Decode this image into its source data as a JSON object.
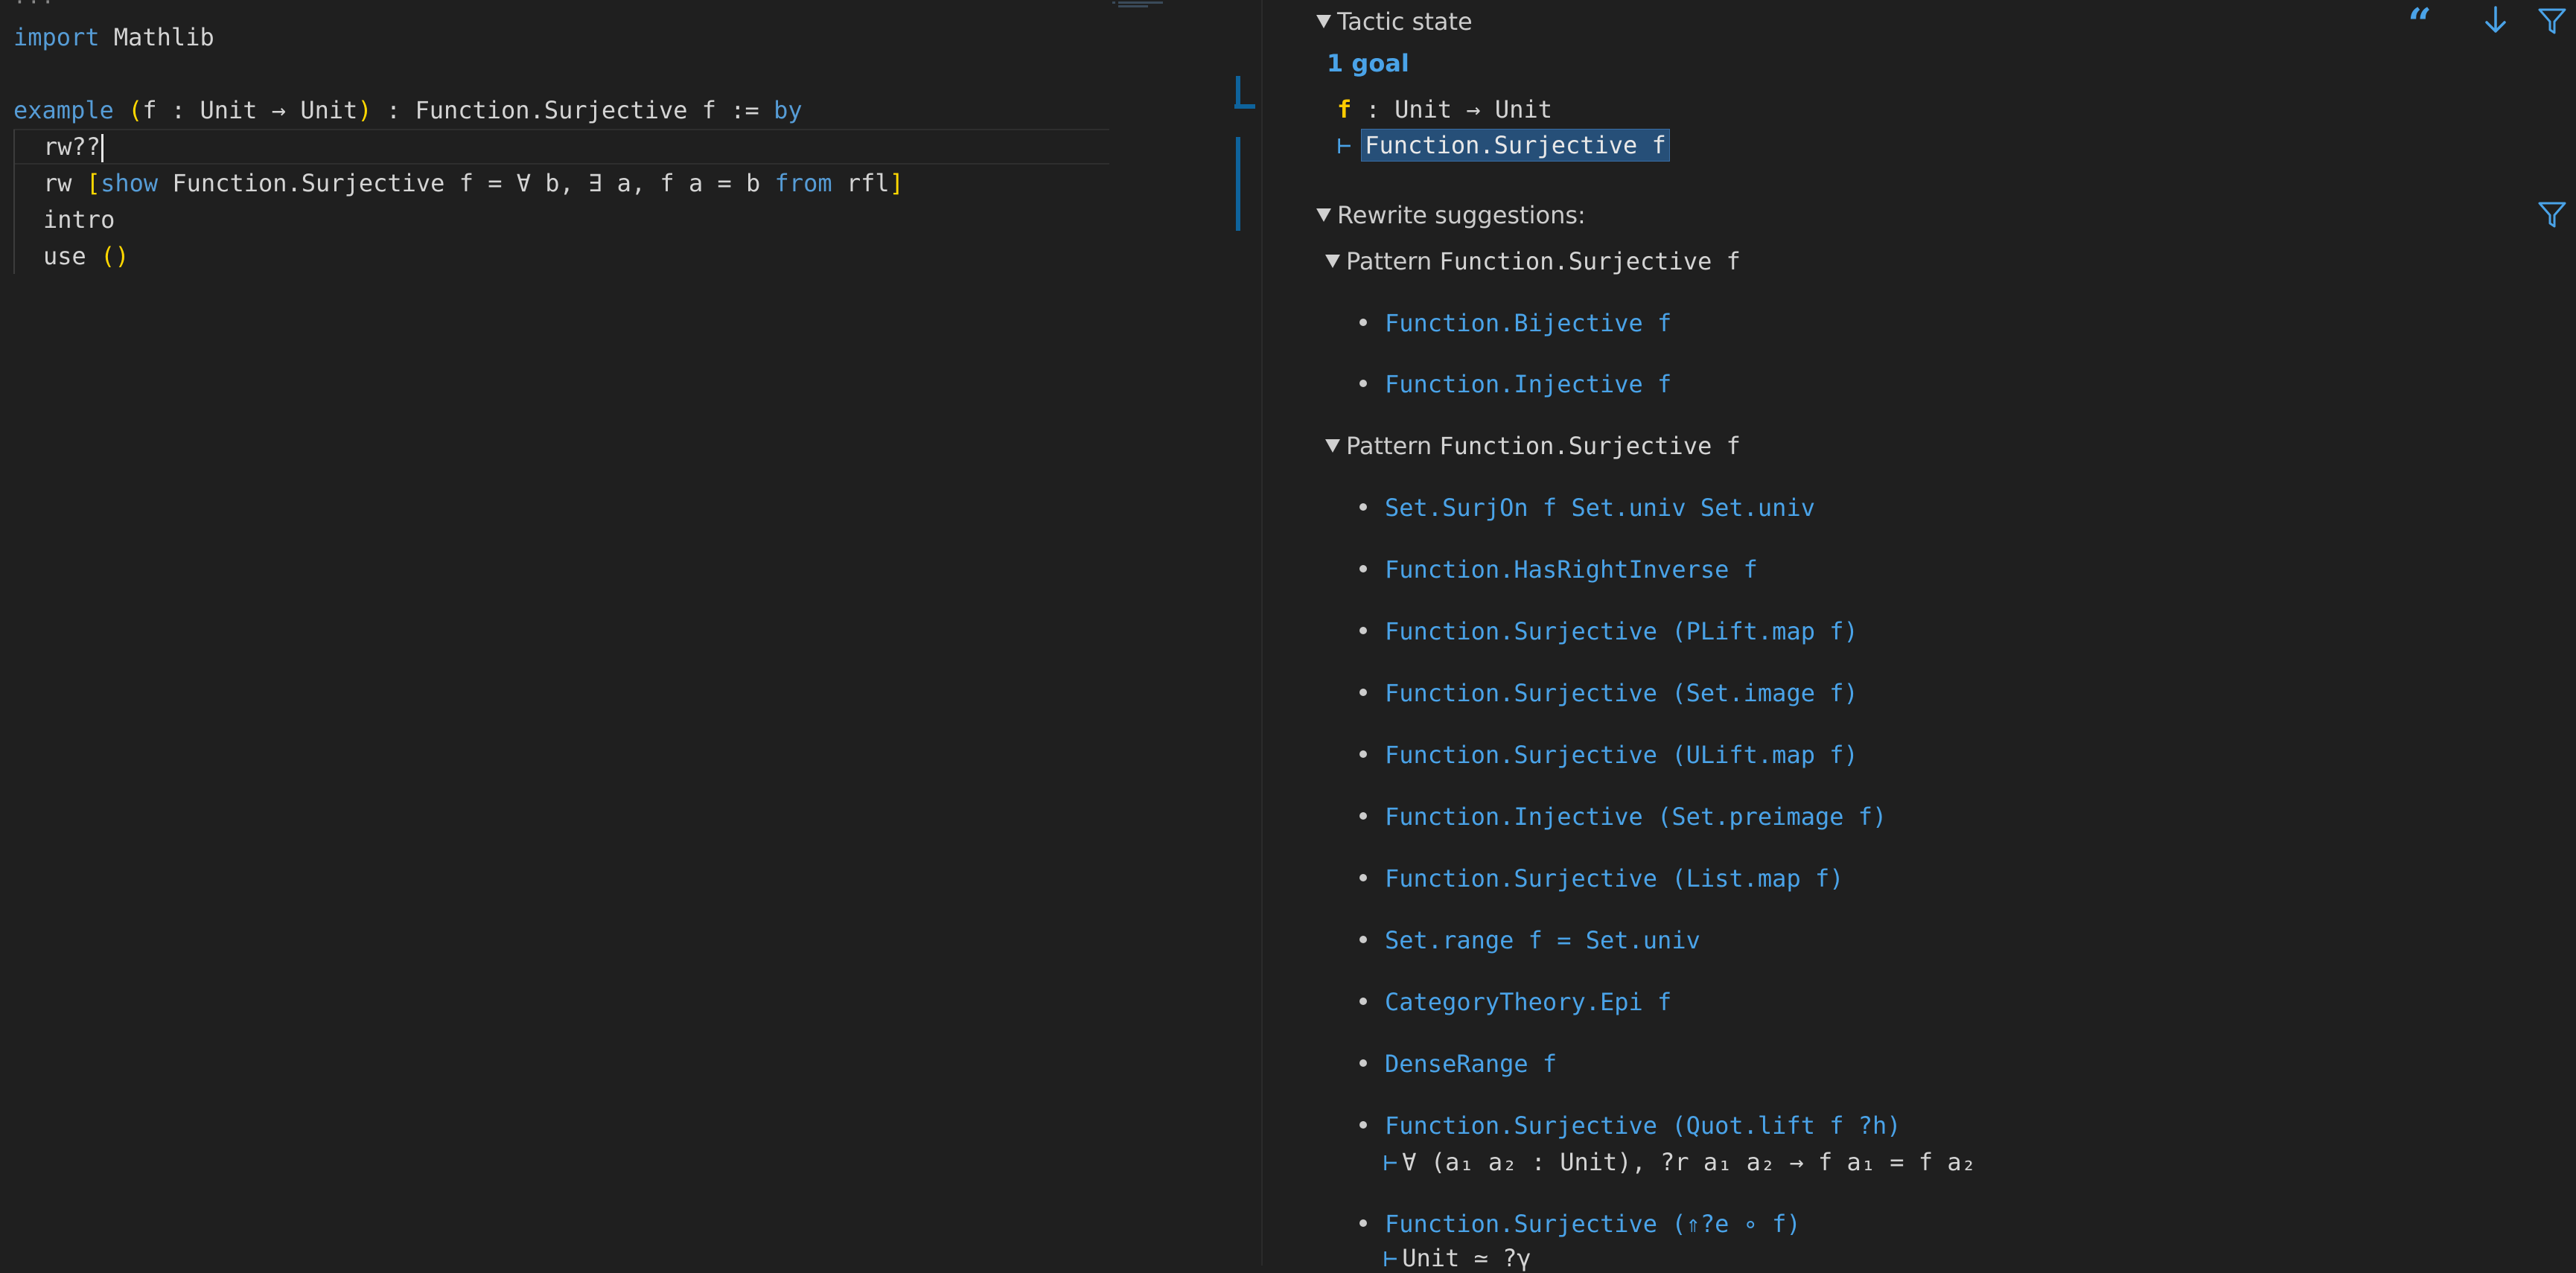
{
  "editor": {
    "fold_marker": "···",
    "lines": [
      {
        "kw1": "import",
        "rest": " Mathlib"
      },
      {
        "kw1": "example",
        "sp": " ",
        "open": "(",
        "params": "f : Unit → Unit",
        "close": ")",
        "mid": " : Function.Surjective f := ",
        "kw2": "by"
      },
      {
        "text": "rw??"
      },
      {
        "pre": "rw ",
        "open": "[",
        "kw1": "show",
        "mid": " Function.Surjective f = ∀ b, ∃ a, f a = b ",
        "kw2": "from",
        "rest": " rfl",
        "close": "]"
      },
      {
        "text": "intro"
      },
      {
        "pre": "use ",
        "open": "(",
        "close": ")"
      }
    ]
  },
  "infoview": {
    "tactic_state_label": "Tactic state",
    "goal_count": "1 goal",
    "hypothesis": {
      "name": "f",
      "type": " : Unit → Unit"
    },
    "turnstile": "⊢",
    "goal": "Function.Surjective f",
    "rewrite_label": "Rewrite suggestions:",
    "groups": [
      {
        "pattern_label": "Pattern",
        "pattern": "Function.Surjective f",
        "items": [
          "Function.Bijective f",
          "Function.Injective f"
        ]
      },
      {
        "pattern_label": "Pattern",
        "pattern": "Function.Surjective f",
        "items": [
          "Set.SurjOn f Set.univ Set.univ",
          "Function.HasRightInverse f",
          "Function.Surjective (PLift.map f)",
          "Function.Surjective (Set.image f)",
          "Function.Surjective (ULift.map f)",
          "Function.Injective (Set.preimage f)",
          "Function.Surjective (List.map f)",
          "Set.range f = Set.univ",
          "CategoryTheory.Epi f",
          "DenseRange f",
          "Function.Surjective (Quot.lift f ?h)",
          "Function.Surjective (⇑?e ∘ f)"
        ],
        "side_goals": [
          "∀ (a₁ a₂ : Unit), ?r a₁ a₂ → f a₁ = f a₂",
          "Unit ≃ ?γ"
        ]
      }
    ],
    "icons": [
      "quote-icon",
      "arrow-down-icon",
      "filter-icon"
    ]
  }
}
